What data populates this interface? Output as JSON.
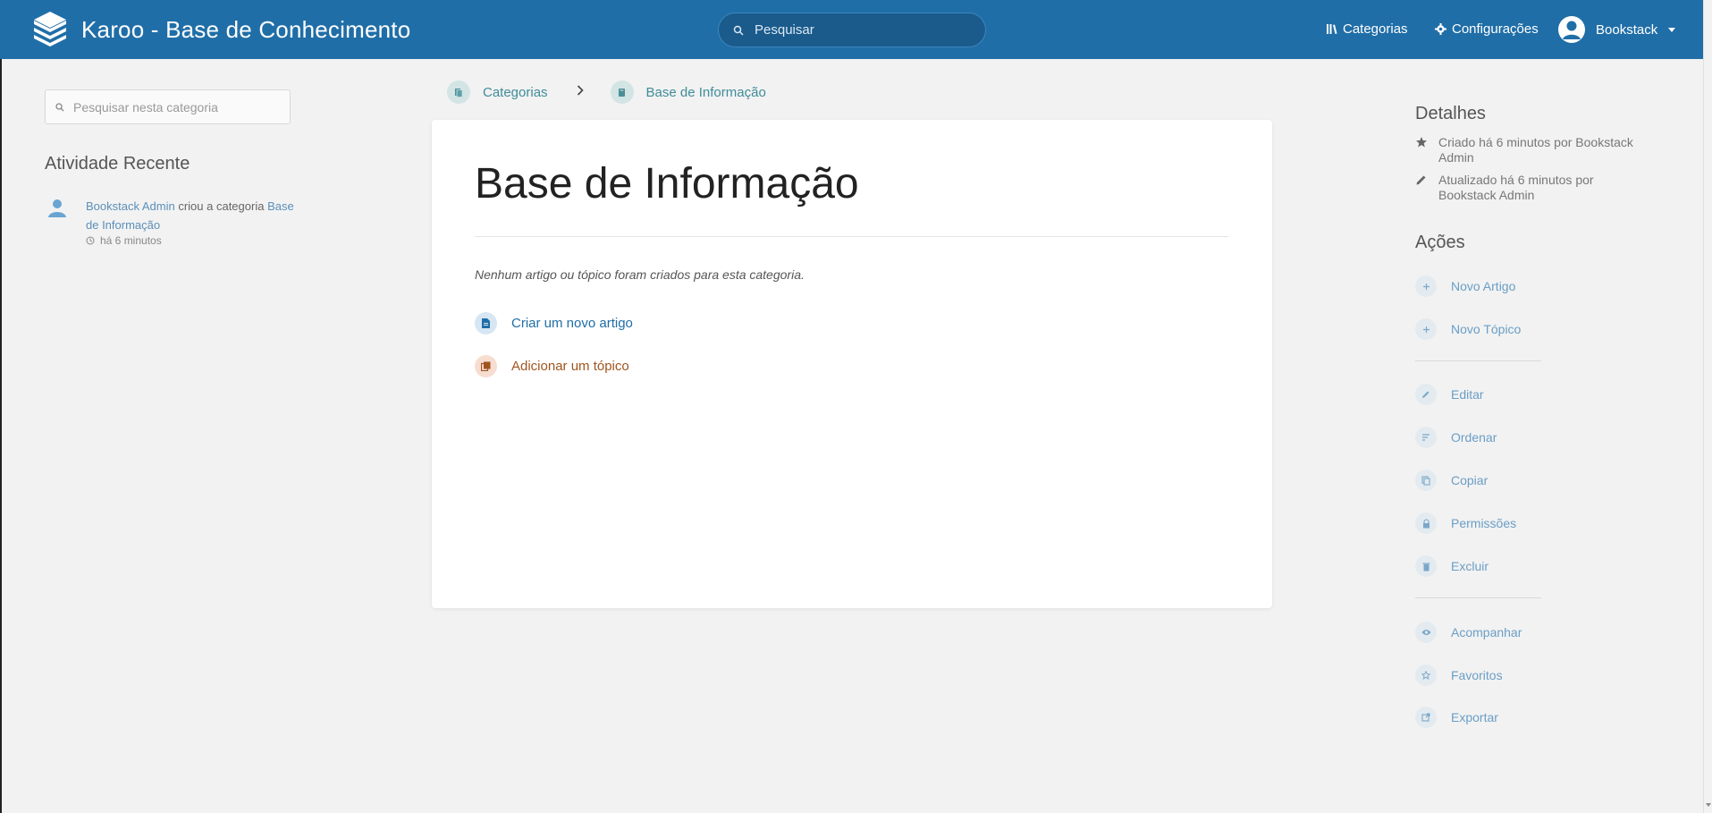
{
  "header": {
    "app_title": "Karoo - Base de Conhecimento",
    "search_placeholder": "Pesquisar",
    "nav_categorias": "Categorias",
    "nav_configuracoes": "Configurações",
    "user_name": "Bookstack",
    "brand_color": "#206ea7"
  },
  "left": {
    "search_placeholder": "Pesquisar nesta categoria",
    "recent_title": "Atividade Recente",
    "activity": {
      "user": "Bookstack Admin",
      "action": " criou a categoria ",
      "target": "Base de Informação",
      "time": "há 6 minutos"
    }
  },
  "breadcrumb": {
    "root": "Categorias",
    "current": "Base de Informação"
  },
  "main": {
    "title": "Base de Informação",
    "empty_message": "Nenhum artigo ou tópico foram criados para esta categoria.",
    "create_article": "Criar um novo artigo",
    "add_topic": "Adicionar um tópico"
  },
  "right": {
    "details_title": "Detalhes",
    "created": "Criado há 6 minutos por Bookstack Admin",
    "updated": "Atualizado há 6 minutos por Bookstack Admin",
    "actions_title": "Ações",
    "actions": {
      "new_article": "Novo Artigo",
      "new_topic": "Novo Tópico",
      "edit": "Editar",
      "sort": "Ordenar",
      "copy": "Copiar",
      "permissions": "Permissões",
      "delete": "Excluir",
      "follow": "Acompanhar",
      "favorites": "Favoritos",
      "export": "Exportar"
    }
  }
}
